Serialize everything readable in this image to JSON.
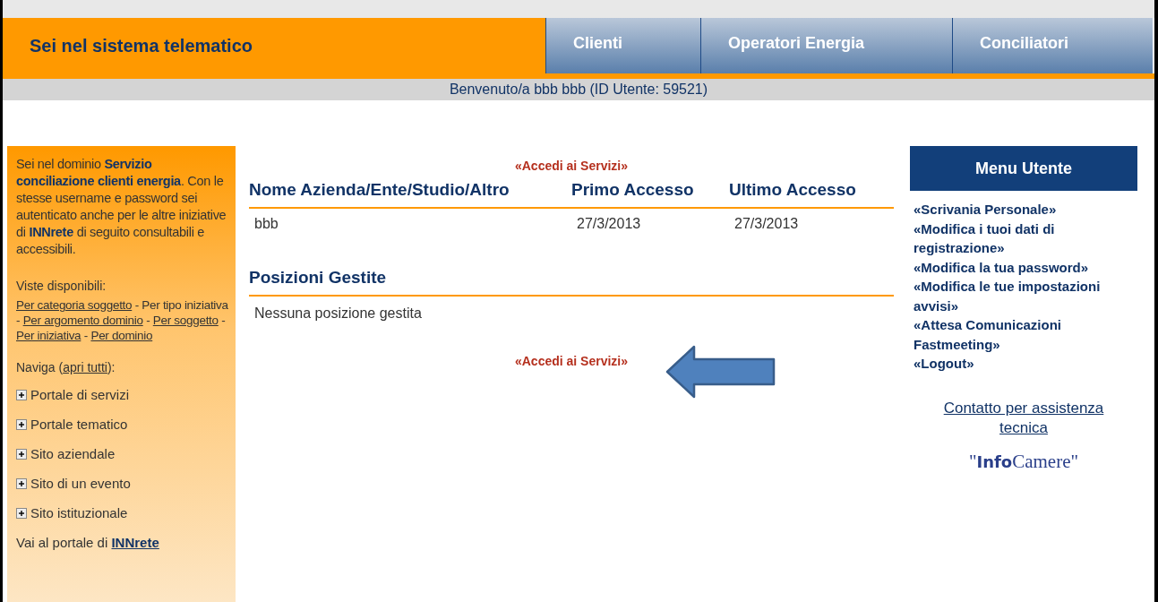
{
  "header": {
    "title": "Sei nel sistema telematico",
    "tabs": [
      "Clienti",
      "Operatori Energia",
      "Conciliatori"
    ]
  },
  "welcome": "Benvenuto/a bbb bbb (ID Utente: 59521)",
  "sidebar": {
    "intro": "Sei nel dominio **Servizio conciliazione clienti energia**. Con le stesse username e password sei autenticato anche per le altre iniziative di **INNrete** di seguito consultabili e accessibili.",
    "views_label": "Viste disponibili:",
    "views": [
      {
        "text": "Per categoria soggetto",
        "link": true
      },
      {
        "text": " - Per tipo iniziativa - ",
        "link": false
      },
      {
        "text": "Per argomento dominio",
        "link": true
      },
      {
        "text": " - ",
        "link": false
      },
      {
        "text": "Per soggetto",
        "link": true
      },
      {
        "text": " - ",
        "link": false
      },
      {
        "text": "Per iniziativa",
        "link": true
      },
      {
        "text": " - ",
        "link": false
      },
      {
        "text": "Per dominio",
        "link": true
      }
    ],
    "navigate": [
      {
        "text": "Naviga (",
        "link": false
      },
      {
        "text": "apri tutti",
        "link": true
      },
      {
        "text": "):",
        "link": false
      }
    ],
    "tree": [
      {
        "label": "Portale di servizi",
        "expanded": false
      },
      {
        "label": "Portale tematico",
        "expanded": false
      },
      {
        "label": "Sito aziendale",
        "expanded": false
      },
      {
        "label": "Sito di un evento",
        "expanded": false
      },
      {
        "label": "Sito istituzionale",
        "expanded": false
      }
    ],
    "footer_text": "Vai al portale di ",
    "footer_link": "INNrete"
  },
  "main": {
    "access_link_top": "«Accedi ai Servizi»",
    "table": {
      "columns": [
        "Nome Azienda/Ente/Studio/Altro",
        "Primo Accesso",
        "Ultimo Accesso"
      ],
      "rows": [
        [
          "bbb",
          "27/3/2013",
          "27/3/2013"
        ]
      ]
    },
    "positions_title": "Posizioni Gestite",
    "positions_empty": "Nessuna posizione gestita",
    "access_link_bottom": "«Accedi ai Servizi»"
  },
  "user_menu": {
    "title": "Menu Utente",
    "items": [
      "«Scrivania Personale»",
      "«Modifica i tuoi dati di registrazione»",
      "«Modifica la tua password»",
      "«Modifica le tue impostazioni avvisi»",
      "«Attesa Comunicazioni Fastmeeting»",
      "«Logout»"
    ],
    "support_link": "Contatto per assistenza tecnica",
    "logo": "\"**Info**Camere\""
  }
}
